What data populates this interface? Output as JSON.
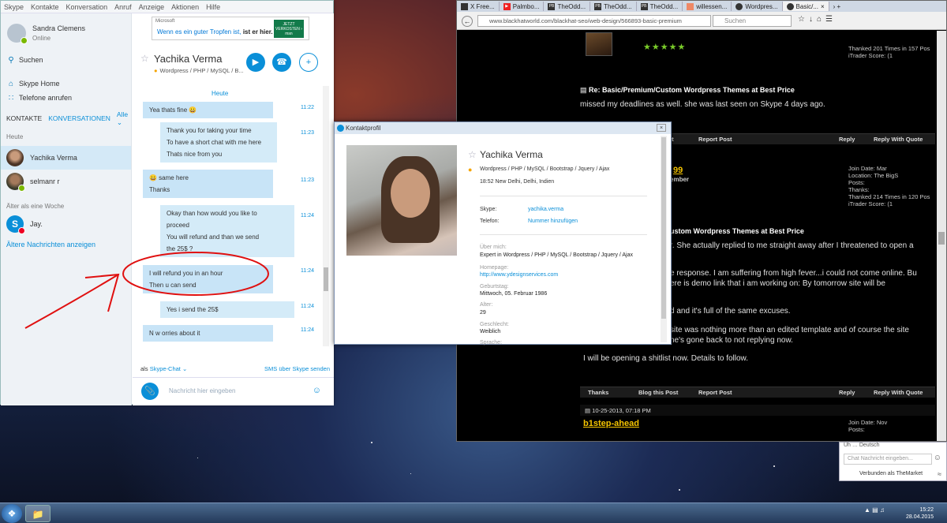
{
  "skype": {
    "menu": [
      "Skype",
      "Kontakte",
      "Konversation",
      "Anruf",
      "Anzeige",
      "Aktionen",
      "Hilfe"
    ],
    "profile": {
      "name": "Sandra Clemens",
      "status": "Online"
    },
    "nav": {
      "search": "Suchen",
      "home": "Skype Home",
      "call_phones": "Telefone anrufen"
    },
    "tabs": {
      "contacts": "KONTAKTE",
      "conversations": "KONVERSATIONEN",
      "all": "Alle"
    },
    "section_today": "Heute",
    "contacts_today": [
      {
        "name": "Yachika Verma"
      },
      {
        "name": "selmanr r"
      }
    ],
    "section_older": "Älter als eine Woche",
    "contacts_older": [
      {
        "name": "Jay."
      }
    ],
    "show_older_link": "Ältere Nachrichten anzeigen",
    "ad": {
      "brand": "Microsoft",
      "text_blue": "Wenn es ein guter Tropfen ist,",
      "text_bold": "ist er hier.",
      "logo": "JETZT VERKOSTEN ›  msn"
    },
    "chat": {
      "name": "Yachika Verma",
      "mood": "Wordpress / PHP / MySQL / B...",
      "date_sep": "Heute",
      "messages": [
        {
          "lines": [
            "Yea thats fine 😀"
          ],
          "time": "11:22"
        },
        {
          "lines": [
            "Thank you for taking your time",
            "To have a short chat with me here",
            "Thats nice from you"
          ],
          "time": "11:23"
        },
        {
          "lines": [
            "😀 same here",
            "Thanks"
          ],
          "time": "11:23"
        },
        {
          "lines": [
            "Okay than how would you like to",
            "proceed",
            "You will refund and than we send",
            "the 25$ ?"
          ],
          "time": "11:24"
        },
        {
          "lines": [
            "I will refund you in an hour",
            "Then u can send"
          ],
          "time": "11:24"
        },
        {
          "lines": [
            "Yes i send the 25$"
          ],
          "time": "11:24"
        },
        {
          "lines": [
            "N w orries about it"
          ],
          "time": "11:24"
        }
      ],
      "footer_as": "als",
      "footer_via": "Skype-Chat",
      "footer_sms": "SMS über Skype senden",
      "input_placeholder": "Nachricht hier eingeben"
    }
  },
  "firefox": {
    "tabs": [
      "X Free...",
      "Palmbo...",
      "TheOdd...",
      "TheOdd...",
      "TheOdd...",
      "willessen...",
      "Wordpres...",
      "Basic/..."
    ],
    "url": "www.blackhatworld.com/blackhat-seo/web-design/566893-basic-premium",
    "search_placeholder": "Suchen",
    "page": {
      "stats1": [
        "Thanked 201 Times in 157 Pos",
        "iTrader Score:                    (1"
      ],
      "post1_title": "Re: Basic/Premium/Custom Wordpress Themes at Best Price",
      "post1_text": "missed my deadlines as well. she was last seen on Skype 4 days ago.",
      "bar1": [
        "st",
        "Report Post",
        "Reply",
        "Reply With Quote"
      ],
      "user2_fragment": "99",
      "user2_title": "ember",
      "stats2": [
        "Join Date:                           Mar",
        "Location:                    The BigS",
        "Posts:",
        "Thanks:",
        "Thanked 214 Times in 120 Pos",
        "iTrader Score:                    (1"
      ],
      "post2_title": "ustom Wordpress Themes at Best Price",
      "post2_lines": [
        "r. She actually replied to me straight away after I threatened to open a",
        "e response. I am suffering from high fever...i could not come online. Bu",
        "ere is demo link that i am working on: By tomorrow site will be",
        "d and it's full of the same excuses.",
        " site was nothing more than an edited template and of course the site",
        "he's gone back to not replying now.",
        "I will be opening a shitlist now. Details to follow."
      ],
      "bar2": [
        "Thanks",
        "Blog this Post",
        "Report Post",
        "Reply",
        "Reply With Quote"
      ],
      "date3": "10-25-2013,     07:18 PM",
      "user3": "b1step-ahead",
      "stats3": [
        "Join Date:                               Nov",
        "Posts:"
      ]
    }
  },
  "dialog": {
    "title": "Kontaktprofil",
    "name": "Yachika Verma",
    "mood": "Wordpress / PHP / MySQL / Bootstrap / Jquery / Ajax",
    "localtime": "18:52 New Delhi, Delhi, Indien",
    "skype_label": "Skype:",
    "skype_value": "yachika.verma",
    "phone_label": "Telefon:",
    "phone_value": "Nummer hinzufügen",
    "about_label": "Über mich:",
    "about_value": "Expert in Wordpress / PHP / MySQL / Bootstrap / Jquery / Ajax",
    "homepage_label": "Homepage:",
    "homepage_value": "http://www.ydesignservices.com",
    "birthday_label": "Geburtstag:",
    "birthday_value": "Mittwoch, 05. Februar 1986",
    "age_label": "Alter:",
    "age_value": "29",
    "gender_label": "Geschlecht:",
    "gender_value": "Weiblich",
    "language_label": "Sprache:"
  },
  "minichat": {
    "top": "Üh … Deutsch",
    "placeholder": "Chat Nachricht eingeben...",
    "status": "Verbunden als TheMarket"
  },
  "taskbar": {
    "time": "15:22",
    "date": "28.04.2015"
  },
  "colors": {
    "skype_blue": "#0a8fd8",
    "bubble": "#c8e4f7",
    "annotation_red": "#e01010",
    "forum_gold": "#f5c400"
  }
}
